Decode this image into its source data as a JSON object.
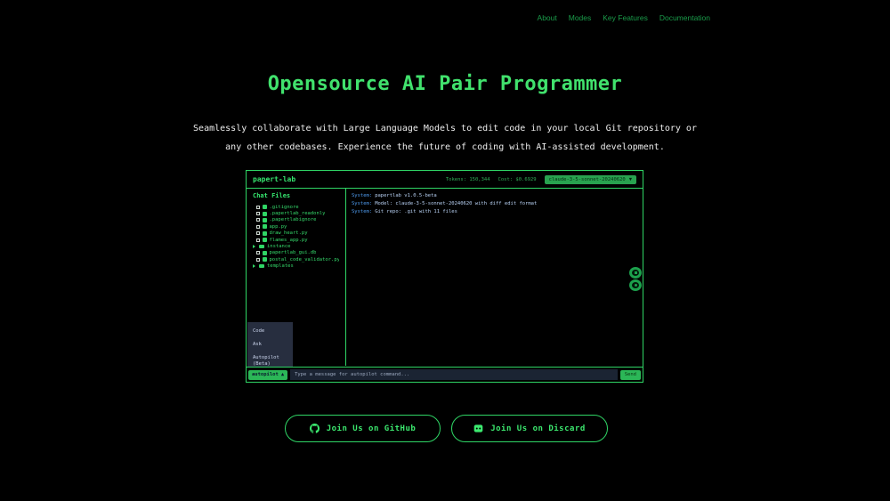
{
  "nav": {
    "items": [
      {
        "label": "About"
      },
      {
        "label": "Modes"
      },
      {
        "label": "Key Features"
      },
      {
        "label": "Documentation"
      }
    ]
  },
  "hero": {
    "title": "Opensource AI Pair Programmer",
    "subtitle_line1": "Seamlessly collaborate with Large Language Models to edit code in your local Git repository or",
    "subtitle_line2": "any other codebases. Experience the future of coding with AI-assisted development."
  },
  "app": {
    "title": "papert-lab",
    "stats": {
      "tokens": "Tokens: 150,344",
      "cost": "Cost: $0.6929"
    },
    "model_select": {
      "value": "claude-3-5-sonnet-20240620",
      "caret": "▼"
    },
    "sidebar": {
      "header": "Chat Files",
      "files": [
        {
          "name": ".gitignore",
          "type": "file"
        },
        {
          "name": ".papertlab_readonly",
          "type": "file"
        },
        {
          "name": ".papertlabignore",
          "type": "file"
        },
        {
          "name": "app.py",
          "type": "file"
        },
        {
          "name": "draw_heart.py",
          "type": "file"
        },
        {
          "name": "flames_app.py",
          "type": "file"
        },
        {
          "name": "instance",
          "type": "folder"
        },
        {
          "name": "papertlab_gui.db",
          "type": "file"
        },
        {
          "name": "postal_code_validator.py",
          "type": "file"
        },
        {
          "name": "templates",
          "type": "folder"
        }
      ]
    },
    "chat": {
      "messages": [
        {
          "label": "System:",
          "text": "papertlab v1.0.5-beta"
        },
        {
          "label": "System:",
          "text": "Model: claude-3-5-sonnet-20240620 with diff edit format"
        },
        {
          "label": "System:",
          "text": "Git repo: .git with 11 files"
        }
      ]
    },
    "mode_menu": {
      "items": [
        {
          "label": "Code"
        },
        {
          "label": "Ask"
        },
        {
          "label": "Autopilot (Beta)"
        }
      ]
    },
    "composer": {
      "mode_button": "autopilot",
      "mode_caret": "▲",
      "input_placeholder": "Type a message for autopilot command...",
      "send_label": "Send"
    }
  },
  "footer": {
    "github_button": "Join Us on GitHub",
    "discord_button": "Join Us on Discard"
  },
  "colors": {
    "background": "#000000",
    "accent_green": "#2fd565",
    "title_green": "#41e26d",
    "nav_green": "#1a9c4a",
    "system_label_blue": "#4f9cf0",
    "system_text_blue": "#b9d2f5",
    "menu_bg": "#272e3f",
    "button_green": "#2bb757"
  }
}
